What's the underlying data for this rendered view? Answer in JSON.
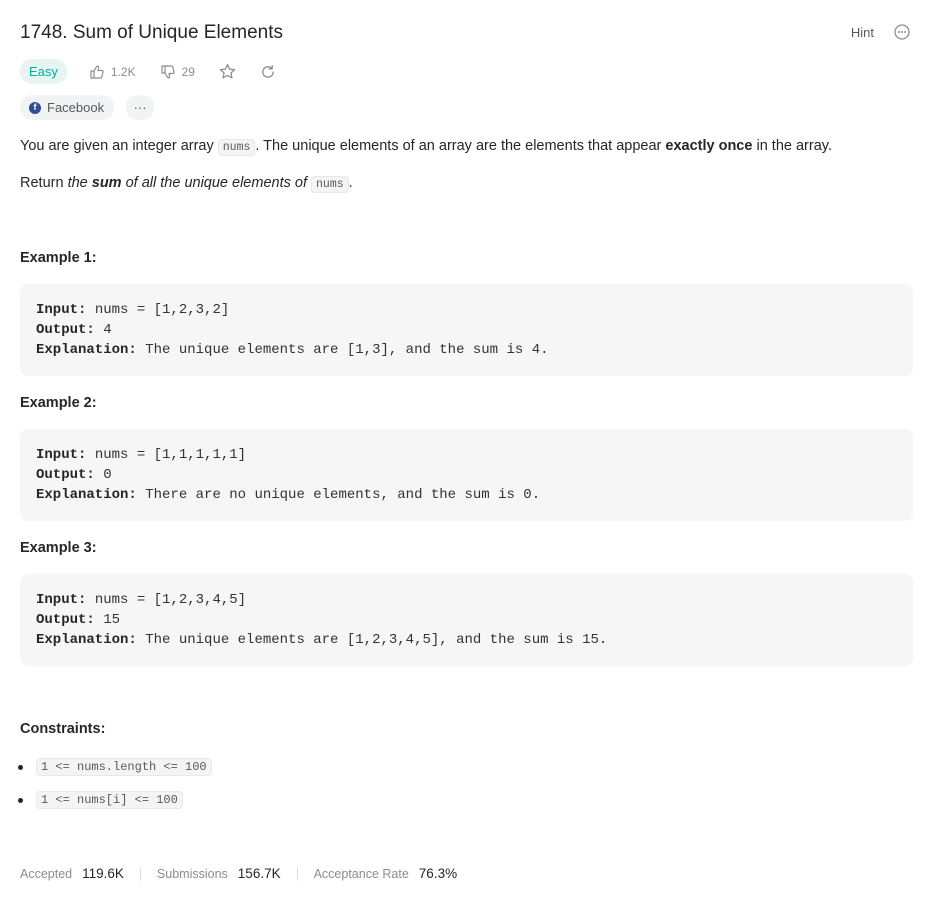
{
  "problem": {
    "title": "1748. Sum of Unique Elements",
    "difficulty": "Easy",
    "likes": "1.2K",
    "dislikes": "29"
  },
  "header_actions": {
    "hint": "Hint"
  },
  "tags": {
    "company": "Facebook",
    "more": "···"
  },
  "description": {
    "p1_a": "You are given an integer array ",
    "p1_code": "nums",
    "p1_b": ". The unique elements of an array are the elements that appear ",
    "p1_bold": "exactly once",
    "p1_c": " in the array.",
    "p2_a": "Return ",
    "p2_i1": "the ",
    "p2_bi": "sum",
    "p2_i2": " of all the unique elements of ",
    "p2_code": "nums",
    "p2_end": "."
  },
  "examples": [
    {
      "title": "Example 1:",
      "input_label": "Input:",
      "input": " nums = [1,2,3,2]",
      "output_label": "Output:",
      "output": " 4",
      "expl_label": "Explanation:",
      "expl": " The unique elements are [1,3], and the sum is 4."
    },
    {
      "title": "Example 2:",
      "input_label": "Input:",
      "input": " nums = [1,1,1,1,1]",
      "output_label": "Output:",
      "output": " 0",
      "expl_label": "Explanation:",
      "expl": " There are no unique elements, and the sum is 0."
    },
    {
      "title": "Example 3:",
      "input_label": "Input:",
      "input": " nums = [1,2,3,4,5]",
      "output_label": "Output:",
      "output": " 15",
      "expl_label": "Explanation:",
      "expl": " The unique elements are [1,2,3,4,5], and the sum is 15."
    }
  ],
  "constraints": {
    "title": "Constraints:",
    "items": [
      "1 <= nums.length <= 100",
      "1 <= nums[i] <= 100"
    ]
  },
  "stats": {
    "accepted_label": "Accepted",
    "accepted": "119.6K",
    "submissions_label": "Submissions",
    "submissions": "156.7K",
    "rate_label": "Acceptance Rate",
    "rate": "76.3%"
  }
}
